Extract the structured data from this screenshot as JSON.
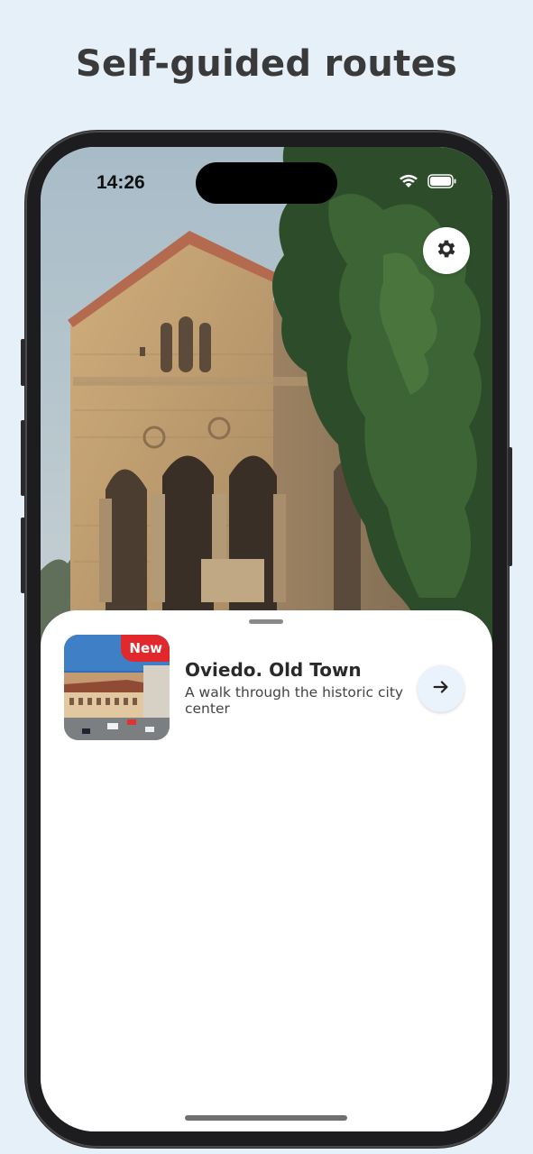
{
  "headline": "Self-guided routes",
  "status_bar": {
    "time": "14:26",
    "icons": [
      "wifi-icon",
      "battery-icon"
    ]
  },
  "hero": {
    "settings_icon": "gear-icon"
  },
  "routes": [
    {
      "badge": "New",
      "title": "Oviedo. Old Town",
      "description": "A walk through the historic city center",
      "action_icon": "arrow-right-icon"
    }
  ],
  "colors": {
    "background": "#e6f0f8",
    "badge": "#e0282d",
    "action_button": "#eaf2fb",
    "headline": "#3a3a3a"
  }
}
